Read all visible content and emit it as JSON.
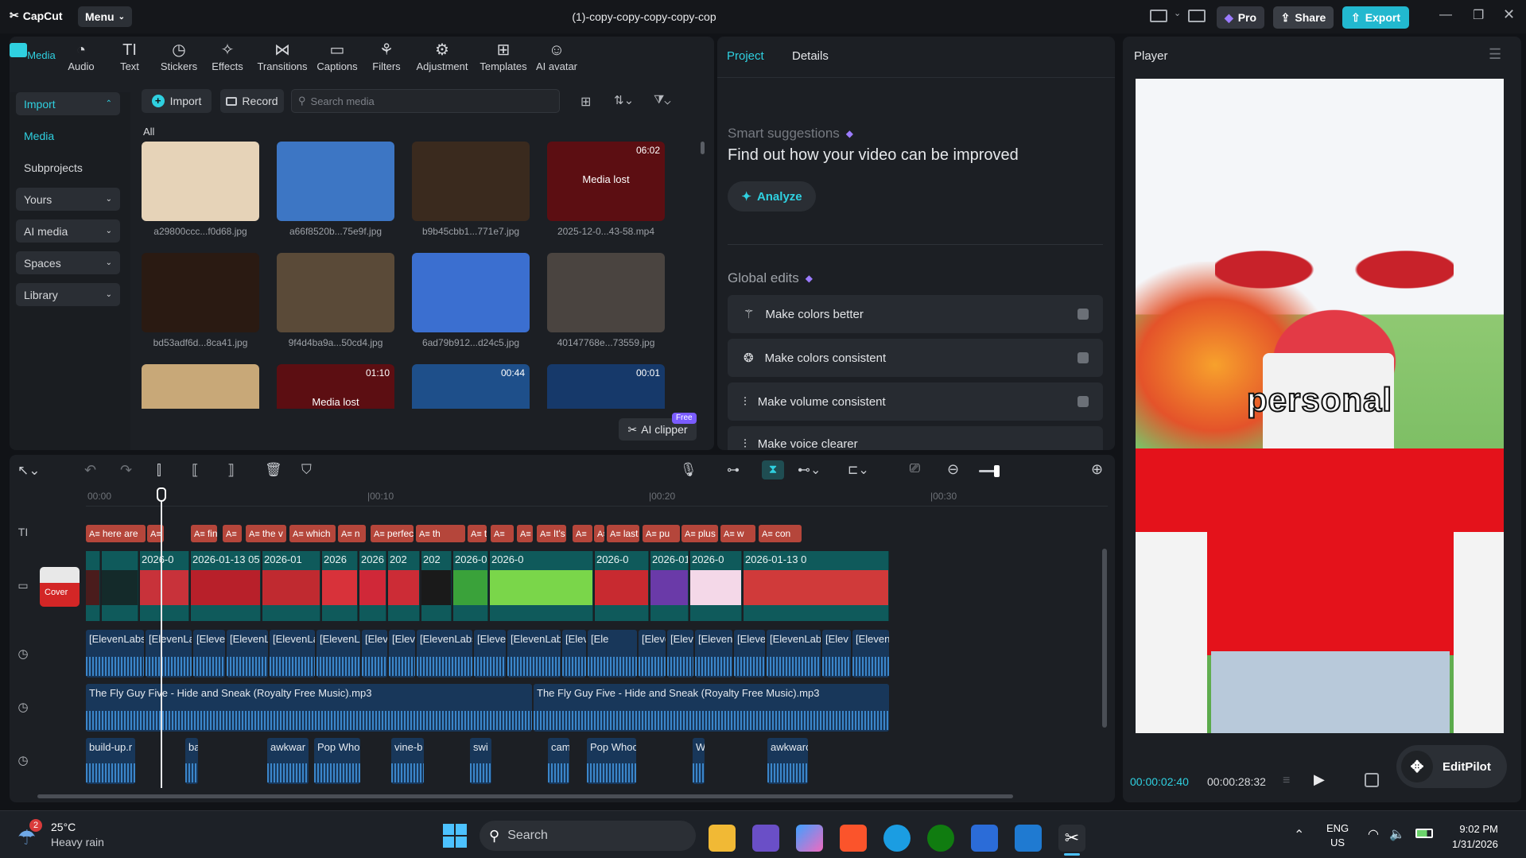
{
  "app": {
    "name": "CapCut",
    "menu_label": "Menu",
    "project_title": "(1)-copy-copy-copy-copy-cop"
  },
  "titlebar": {
    "pro_label": "Pro",
    "share_label": "Share",
    "export_label": "Export"
  },
  "toolbar": [
    "Media",
    "Audio",
    "Text",
    "Stickers",
    "Effects",
    "Transitions",
    "Captions",
    "Filters",
    "Adjustment",
    "Templates",
    "AI avatar"
  ],
  "sidebar": {
    "import": "Import",
    "media": "Media",
    "subprojects": "Subprojects",
    "yours": "Yours",
    "ai_media": "AI media",
    "spaces": "Spaces",
    "library": "Library"
  },
  "media_bar": {
    "import": "Import",
    "record": "Record",
    "search_placeholder": "Search media",
    "filter_all": "All"
  },
  "media_items": [
    {
      "name": "a29800ccc...f0d68.jpg",
      "duration": "",
      "lost": false,
      "color": "#e6d3b8"
    },
    {
      "name": "a66f8520b...75e9f.jpg",
      "duration": "",
      "lost": false,
      "color": "#3d76c4"
    },
    {
      "name": "b9b45cbb1...771e7.jpg",
      "duration": "",
      "lost": false,
      "color": "#3a2a1e"
    },
    {
      "name": "2025-12-0...43-58.mp4",
      "duration": "06:02",
      "lost": true,
      "lost_text": "Media lost",
      "color": "#5c0e12"
    },
    {
      "name": "bd53adf6d...8ca41.jpg",
      "duration": "",
      "lost": false,
      "color": "#2a1a12"
    },
    {
      "name": "9f4d4ba9a...50cd4.jpg",
      "duration": "",
      "lost": false,
      "color": "#5a4a38"
    },
    {
      "name": "6ad79b912...d24c5.jpg",
      "duration": "",
      "lost": false,
      "color": "#3b6fd0"
    },
    {
      "name": "40147768e...73559.jpg",
      "duration": "",
      "lost": false,
      "color": "#4a4440"
    },
    {
      "name": "",
      "duration": "",
      "lost": false,
      "color": "#c8a878"
    },
    {
      "name": "",
      "duration": "01:10",
      "lost": true,
      "lost_text": "Media lost",
      "color": "#5c0e12"
    },
    {
      "name": "",
      "duration": "00:44",
      "lost": false,
      "color": "#1e4f8a"
    },
    {
      "name": "",
      "duration": "00:01",
      "lost": false,
      "color": "#16396a"
    }
  ],
  "ai_clipper": {
    "label": "AI clipper",
    "badge": "Free"
  },
  "project_panel": {
    "tabs": [
      "Project",
      "Details"
    ],
    "smart_title": "Smart suggestions",
    "smart_text": "Find out how your video can be improved",
    "analyze": "Analyze",
    "global_title": "Global edits",
    "global_edits": [
      "Make colors better",
      "Make colors consistent",
      "Make volume consistent",
      "Make voice clearer"
    ]
  },
  "player": {
    "title": "Player",
    "overlay_text": "personal",
    "current_time": "00:00:02:40",
    "total_time": "00:00:28:32",
    "editpilot": "EditPilot"
  },
  "timeline": {
    "ruler": [
      "00:00",
      "|00:10",
      "|00:20",
      "|00:30"
    ],
    "text_clips": [
      "here are",
      "",
      "fin",
      "",
      "the v",
      "which",
      "n",
      "perfecti",
      "th",
      "the glo",
      "",
      "",
      "It's",
      "",
      "",
      "last",
      "pu",
      "plus it i",
      "w",
      "con"
    ],
    "video_clips": [
      "",
      "",
      "2026-0",
      "2026-01-13 05",
      "2026-01",
      "2026",
      "2026",
      "202",
      "202",
      "2026-01-13 05:",
      "2026-0",
      "2026-0",
      "2026-01-1:",
      "2026-0",
      "2026-01-13 0"
    ],
    "voice_clips": [
      "[ElevenLabs",
      "[ElevenLa",
      "[Eleve",
      "[ElevenL",
      "[ElevenLa",
      "[ElevenLa",
      "[Elev",
      "[Elev",
      "[ElevenLabs",
      "[Eleve",
      "[ElevenLab",
      "[Elev",
      "[Ele",
      "[Elever",
      "[ElevenL",
      "[Eleven",
      "[Eleve",
      "[ElevenLabs",
      "[Elev",
      "[Eleven"
    ],
    "music_clips": [
      "The Fly Guy Five - Hide and Sneak (Royalty Free Music).mp3",
      "The Fly Guy Five - Hide and Sneak (Royalty Free Music).mp3"
    ],
    "sfx_clips": [
      "build-up.r",
      "ba",
      "awkwar",
      "Pop Who",
      "vine-b",
      "swi",
      "cam",
      "Pop Whoc",
      "W",
      "awkwarc"
    ],
    "cover_label": "Cover"
  },
  "taskbar": {
    "weather_temp": "25°C",
    "weather_desc": "Heavy rain",
    "weather_badge": "2",
    "search": "Search",
    "lang1": "ENG",
    "lang2": "US",
    "time": "9:02 PM",
    "date": "1/31/2026"
  },
  "colors": {
    "accent": "#2fd0e0",
    "export_btn": "#22b8cf",
    "text_clip": "#b5463b",
    "video_clip": "#0f5a5b",
    "audio_clip": "#18375a"
  }
}
